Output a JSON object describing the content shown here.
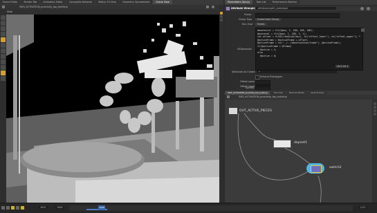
{
  "top_tabs": [
    "Scene Editor",
    "Render Tab",
    "Animation Editor",
    "Composite Network",
    "Motion FX View",
    "Geometry Spreadsheet",
    "Scene View"
  ],
  "right_top_tabs": [
    "Parameters (focus)",
    "Take List",
    "Performance Monitor"
  ],
  "viewport": {
    "path": "SW3_ACTIVATION_proximity_top_building",
    "camera_label": "Persp",
    "view_label": "Note"
  },
  "params": {
    "header_type": "Attribute Wrangle",
    "header_name": "attribwrangle1_prototype",
    "group_label": "Group",
    "group_type_label": "Group Type",
    "group_type_value": "Guess from Group",
    "run_over_label": "Run Over",
    "run_over_value": "Points",
    "vexpression_label": "VEXpression",
    "attrs_to_create_label": "Attributes to Create",
    "attrs_to_create_value": "*",
    "enforce_prototypes_label": "Enforce Prototypes",
    "offset_lower_label": "Offset Lower",
    "offset_upper_label": "Offset Upper",
    "spread_label": "Spread",
    "field_value": "10.5  16  1",
    "code_lines": [
      "#anoteList = fit(@pos, 1, 200, 100, 100);",
      "@pieceval = fit(@pos, 1, 100, 1, 1);",
      "",
      "int offset = fit01(rand(i@class), ch(\"offset_lower\"), ch(\"offset_upper\")) *",
      "@activeFrame = @activeFrame + offset;",
      "",
      "@activeFrame = ch(\"../../deactivation/frame\"), @activeFrame);",
      "",
      "if(@activeFrame > @Frame)",
      "  @active = 1;",
      "else",
      "  @active = 0;"
    ]
  },
  "network": {
    "tabs": [
      "SW3_ACTIVATION_proximity_top_building",
      "Tree View",
      "Material Palette",
      "Asset Browser"
    ],
    "path": "SW3_ACTIVATION_proximity_top_building",
    "nodes": {
      "out": "OUT_ACTIVE_PIECES",
      "dopnet": "dopnet1",
      "switch": "switch2"
    }
  },
  "timeline": {
    "start": "1001",
    "end": "1065",
    "current": "1026",
    "right_value": "1122",
    "ticks": [
      "10",
      "20",
      "30",
      "40",
      "50",
      "60",
      "70",
      "80",
      "90",
      "100"
    ]
  },
  "colors": {
    "accent": "#d8a028",
    "bg": "#2b2b2b",
    "node_purple": "#7070c0",
    "node_selected": "#e0d040",
    "timeline_bar": "#4a7bbd"
  }
}
